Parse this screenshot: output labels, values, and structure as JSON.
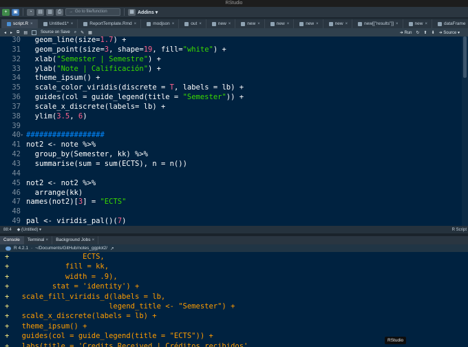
{
  "window": {
    "title": "RStudio"
  },
  "toolbar": {
    "goto_placeholder": "Go to file/function",
    "addins_label": "Addins"
  },
  "editor_tabs": [
    {
      "label": "script.R",
      "active": true
    },
    {
      "label": "Untitled1*",
      "active": false
    },
    {
      "label": "ReportTemplate.Rmd",
      "active": false
    },
    {
      "label": "modjson",
      "active": false
    },
    {
      "label": "out",
      "active": false
    },
    {
      "label": "new",
      "active": false
    },
    {
      "label": "new",
      "active": false
    },
    {
      "label": "new",
      "active": false
    },
    {
      "label": "new",
      "active": false
    },
    {
      "label": "new",
      "active": false
    },
    {
      "label": "new[[\"results\"]]",
      "active": false
    },
    {
      "label": "new",
      "active": false
    },
    {
      "label": "dataFrame",
      "active": false
    }
  ],
  "editor_toolbar": {
    "source_on_save": "Source on Save",
    "run": "Run",
    "source": "Source"
  },
  "code_lines": [
    {
      "n": "30",
      "fold": "",
      "html": "  geom_line(size=<span class=\"c-num\">1.7</span>) +"
    },
    {
      "n": "31",
      "fold": "",
      "html": "  geom_point(size=<span class=\"c-num\">3</span>, shape=<span class=\"c-num\">19</span>, fill=<span class=\"c-str\">\"white\"</span>) +"
    },
    {
      "n": "32",
      "fold": "",
      "html": "  xlab(<span class=\"c-str\">\"Semester | Semestre\"</span>) +"
    },
    {
      "n": "33",
      "fold": "",
      "html": "  ylab(<span class=\"c-str\">\"Note | Calificación\"</span>) +"
    },
    {
      "n": "34",
      "fold": "",
      "html": "  theme_ipsum() +"
    },
    {
      "n": "35",
      "fold": "",
      "html": "  scale_color_viridis(discrete = <span class=\"c-num\">T</span>, labels = lb) +"
    },
    {
      "n": "36",
      "fold": "",
      "html": "  guides(col = guide_legend(title = <span class=\"c-str\">\"Semester\"</span>)) +"
    },
    {
      "n": "37",
      "fold": "",
      "html": "  scale_x_discrete(labels= lb) +"
    },
    {
      "n": "38",
      "fold": "",
      "html": "  ylim(<span class=\"c-num\">3.5</span>, <span class=\"c-num\">6</span>)"
    },
    {
      "n": "39",
      "fold": "",
      "html": ""
    },
    {
      "n": "40",
      "fold": "▾",
      "html": "<span class=\"c-com\">##################</span>"
    },
    {
      "n": "41",
      "fold": "",
      "html": "not2 &lt;- note %&gt;%"
    },
    {
      "n": "42",
      "fold": "",
      "html": "  group_by(Semester, kk) %&gt;%"
    },
    {
      "n": "43",
      "fold": "",
      "html": "  summarise(sum = sum(ECTS), n = n())"
    },
    {
      "n": "44",
      "fold": "",
      "html": ""
    },
    {
      "n": "45",
      "fold": "",
      "html": "not2 &lt;- not2 %&gt;%"
    },
    {
      "n": "46",
      "fold": "",
      "html": "  arrange(kk)"
    },
    {
      "n": "47",
      "fold": "",
      "html": "names(not2)[<span class=\"c-num\">3</span>] = <span class=\"c-str\">\"ECTS\"</span>"
    },
    {
      "n": "48",
      "fold": "",
      "html": ""
    },
    {
      "n": "49",
      "fold": "",
      "html": "pal &lt;- viridis_pal()(<span class=\"c-num\">7</span>)"
    }
  ],
  "status_bar": {
    "position": "88:4",
    "scope": "(Untitled)",
    "filetype": "R Script"
  },
  "console_tabs": [
    {
      "label": "Console",
      "active": true
    },
    {
      "label": "Terminal",
      "active": false
    },
    {
      "label": "Background Jobs",
      "active": false
    }
  ],
  "console_header": {
    "r_version": "R 4.2.1",
    "path": "~/Documents/GitHub/notes_ggplot2/"
  },
  "console_lines": [
    {
      "prompt": "+",
      "text": "                ECTS,"
    },
    {
      "prompt": "+",
      "text": "            fill = kk,"
    },
    {
      "prompt": "+",
      "text": "            width = .9),"
    },
    {
      "prompt": "+",
      "text": "         stat = 'identity') +"
    },
    {
      "prompt": "+",
      "text": "  scale_fill_viridis_d(labels = lb,"
    },
    {
      "prompt": "+",
      "text": "                      legend_title <- \"Semester\") +"
    },
    {
      "prompt": "+",
      "text": "  scale_x_discrete(labels = lb) +"
    },
    {
      "prompt": "+",
      "text": "  theme_ipsum() +"
    },
    {
      "prompt": "+",
      "text": "  guides(col = guide_legend(title = \"ECTS\")) +"
    },
    {
      "prompt": "+",
      "text": "  labs(title = 'Credits Received | Créditos recibidos',"
    }
  ],
  "tooltip": "RStudio"
}
